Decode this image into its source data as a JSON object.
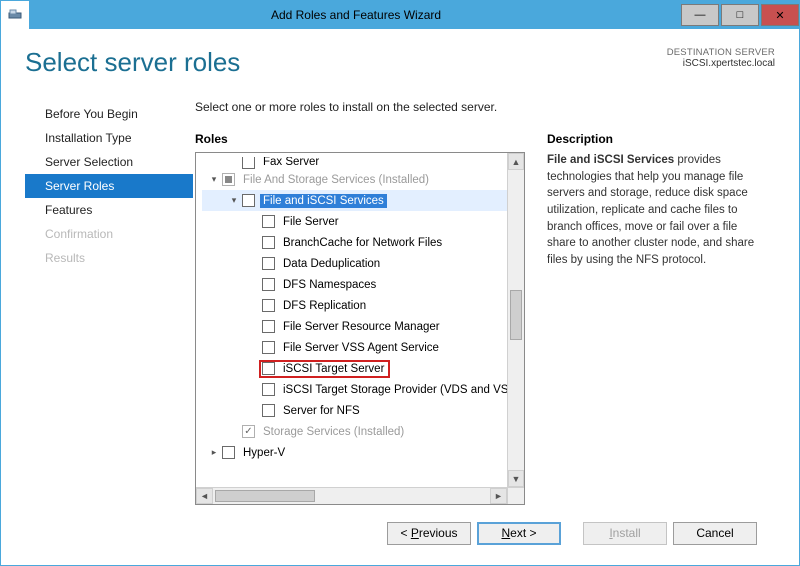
{
  "titlebar": {
    "title": "Add Roles and Features Wizard"
  },
  "header": {
    "page_title": "Select server roles",
    "dest_label": "DESTINATION SERVER",
    "dest_server": "iSCSI.xpertstec.local"
  },
  "nav": {
    "items": [
      {
        "label": "Before You Begin",
        "state": "normal"
      },
      {
        "label": "Installation Type",
        "state": "normal"
      },
      {
        "label": "Server Selection",
        "state": "normal"
      },
      {
        "label": "Server Roles",
        "state": "selected"
      },
      {
        "label": "Features",
        "state": "normal"
      },
      {
        "label": "Confirmation",
        "state": "disabled"
      },
      {
        "label": "Results",
        "state": "disabled"
      }
    ]
  },
  "main": {
    "instruction": "Select one or more roles to install on the selected server.",
    "roles_header": "Roles",
    "desc_header": "Description",
    "desc_lead": "File and iSCSI Services",
    "desc_body": " provides technologies that help you manage file servers and storage, reduce disk space utilization, replicate and cache files to branch offices, move or fail over a file share to another cluster node, and share files by using the NFS protocol."
  },
  "tree": {
    "rows": [
      {
        "indent": 1,
        "toggle": "",
        "cb": "unchecked",
        "label": "Fax Server",
        "disabled": false,
        "cut": true
      },
      {
        "indent": 0,
        "toggle": "▾",
        "cb": "tri",
        "label": "File And Storage Services (Installed)",
        "disabled": true
      },
      {
        "indent": 1,
        "toggle": "▾",
        "cb": "unchecked",
        "label": "File and iSCSI Services",
        "selected": true,
        "row_hl": true
      },
      {
        "indent": 2,
        "toggle": "",
        "cb": "unchecked",
        "label": "File Server"
      },
      {
        "indent": 2,
        "toggle": "",
        "cb": "unchecked",
        "label": "BranchCache for Network Files"
      },
      {
        "indent": 2,
        "toggle": "",
        "cb": "unchecked",
        "label": "Data Deduplication"
      },
      {
        "indent": 2,
        "toggle": "",
        "cb": "unchecked",
        "label": "DFS Namespaces"
      },
      {
        "indent": 2,
        "toggle": "",
        "cb": "unchecked",
        "label": "DFS Replication"
      },
      {
        "indent": 2,
        "toggle": "",
        "cb": "unchecked",
        "label": "File Server Resource Manager"
      },
      {
        "indent": 2,
        "toggle": "",
        "cb": "unchecked",
        "label": "File Server VSS Agent Service"
      },
      {
        "indent": 2,
        "toggle": "",
        "cb": "unchecked",
        "label": "iSCSI Target Server",
        "redbox": true
      },
      {
        "indent": 2,
        "toggle": "",
        "cb": "unchecked",
        "label": "iSCSI Target Storage Provider (VDS and VSS"
      },
      {
        "indent": 2,
        "toggle": "",
        "cb": "unchecked",
        "label": "Server for NFS"
      },
      {
        "indent": 1,
        "toggle": "",
        "cb": "checked",
        "label": "Storage Services (Installed)",
        "disabled": true
      },
      {
        "indent": 0,
        "toggle": "▸",
        "cb": "unchecked",
        "label": "Hyper-V"
      }
    ]
  },
  "footer": {
    "previous": "< Previous",
    "next": "Next >",
    "install": "Install",
    "cancel": "Cancel"
  }
}
